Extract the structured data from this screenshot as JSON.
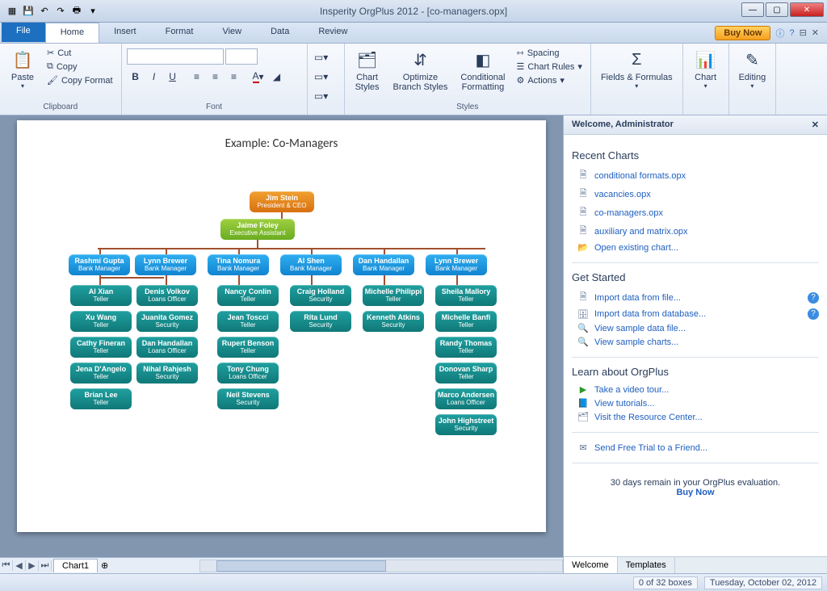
{
  "app_title": "Insperity OrgPlus 2012 - [co-managers.opx]",
  "tabs": {
    "file": "File",
    "home": "Home",
    "insert": "Insert",
    "format": "Format",
    "view": "View",
    "data": "Data",
    "review": "Review"
  },
  "buy_now": "Buy Now",
  "ribbon": {
    "clipboard": {
      "label": "Clipboard",
      "paste": "Paste",
      "cut": "Cut",
      "copy": "Copy",
      "copyformat": "Copy Format"
    },
    "font": {
      "label": "Font"
    },
    "styles": {
      "label": "Styles",
      "chartstyles": "Chart\nStyles",
      "optimize": "Optimize\nBranch Styles",
      "conditional": "Conditional\nFormatting",
      "spacing": "Spacing",
      "chartrules": "Chart Rules",
      "actions": "Actions"
    },
    "fields": {
      "label": "Fields & Formulas",
      "fields": "Fields & Formulas"
    },
    "chart": {
      "label": "Chart",
      "chart": "Chart"
    },
    "editing": {
      "label": "Editing",
      "editing": "Editing"
    }
  },
  "page": {
    "title": "Example: Co-Managers"
  },
  "chart_data": {
    "type": "orgchart",
    "title": "Example: Co-Managers",
    "root": {
      "name": "Jim Stein",
      "title": "President & CEO",
      "class": "ceo"
    },
    "assistant": {
      "name": "Jaime Foley",
      "title": "Executive Assistant",
      "class": "asst"
    },
    "managers": [
      {
        "name": "Rashmi Gupta",
        "title": "Bank Manager"
      },
      {
        "name": "Lynn Brewer",
        "title": "Bank Manager"
      },
      {
        "name": "Tina Nomura",
        "title": "Bank Manager"
      },
      {
        "name": "Al Shen",
        "title": "Bank Manager"
      },
      {
        "name": "Dan Handallan",
        "title": "Bank Manager"
      },
      {
        "name": "Lynn Brewer",
        "title": "Bank Manager"
      }
    ],
    "co_manager_pairs": [
      [
        0,
        1
      ]
    ],
    "columns": [
      [
        {
          "name": "Al Xian",
          "title": "Teller"
        },
        {
          "name": "Xu Wang",
          "title": "Teller"
        },
        {
          "name": "Cathy Fineran",
          "title": "Teller"
        },
        {
          "name": "Jena D'Angelo",
          "title": "Teller"
        },
        {
          "name": "Brian Lee",
          "title": "Teller"
        }
      ],
      [
        {
          "name": "Denis Volkov",
          "title": "Loans Officer"
        },
        {
          "name": "Juanita Gomez",
          "title": "Security"
        },
        {
          "name": "Dan Handallan",
          "title": "Loans Officer"
        },
        {
          "name": "Nihal Rahjesh",
          "title": "Security"
        }
      ],
      [
        {
          "name": "Nancy Conlin",
          "title": "Teller"
        },
        {
          "name": "Jean Toscci",
          "title": "Teller"
        },
        {
          "name": "Rupert Benson",
          "title": "Teller"
        },
        {
          "name": "Tony Chung",
          "title": "Loans Officer"
        },
        {
          "name": "Neil Stevens",
          "title": "Security"
        }
      ],
      [
        {
          "name": "Craig Holland",
          "title": "Security"
        },
        {
          "name": "Rita Lund",
          "title": "Security"
        }
      ],
      [
        {
          "name": "Michelle Philippi",
          "title": "Teller"
        },
        {
          "name": "Kenneth Atkins",
          "title": "Security"
        }
      ],
      [
        {
          "name": "Sheila Mallory",
          "title": "Teller"
        },
        {
          "name": "Michelle Banfi",
          "title": "Teller"
        },
        {
          "name": "Randy Thomas",
          "title": "Teller"
        },
        {
          "name": "Donovan Sharp",
          "title": "Teller"
        },
        {
          "name": "Marco Andersen",
          "title": "Loans Officer"
        },
        {
          "name": "John Highstreet",
          "title": "Security"
        }
      ]
    ]
  },
  "sheet_tab": "Chart1",
  "rightpanel": {
    "header": "Welcome, Administrator",
    "recent_title": "Recent Charts",
    "recent": [
      "conditional formats.opx",
      "vacancies.opx",
      "co-managers.opx",
      "auxiliary and matrix.opx"
    ],
    "open": "Open existing chart...",
    "get_started_title": "Get Started",
    "import_file": "Import data from file...",
    "import_db": "Import data from database...",
    "sample_data": "View sample data file...",
    "sample_charts": "View sample charts...",
    "learn_title": "Learn about OrgPlus",
    "video": "Take a video tour...",
    "tutorials": "View tutorials...",
    "resource": "Visit the Resource Center...",
    "send_trial": "Send Free Trial to a Friend...",
    "eval_msg": "30 days remain in your OrgPlus evaluation.",
    "eval_link": "Buy Now",
    "tab_welcome": "Welcome",
    "tab_templates": "Templates"
  },
  "status": {
    "boxes": "0 of 32 boxes",
    "date": "Tuesday, October 02, 2012"
  }
}
